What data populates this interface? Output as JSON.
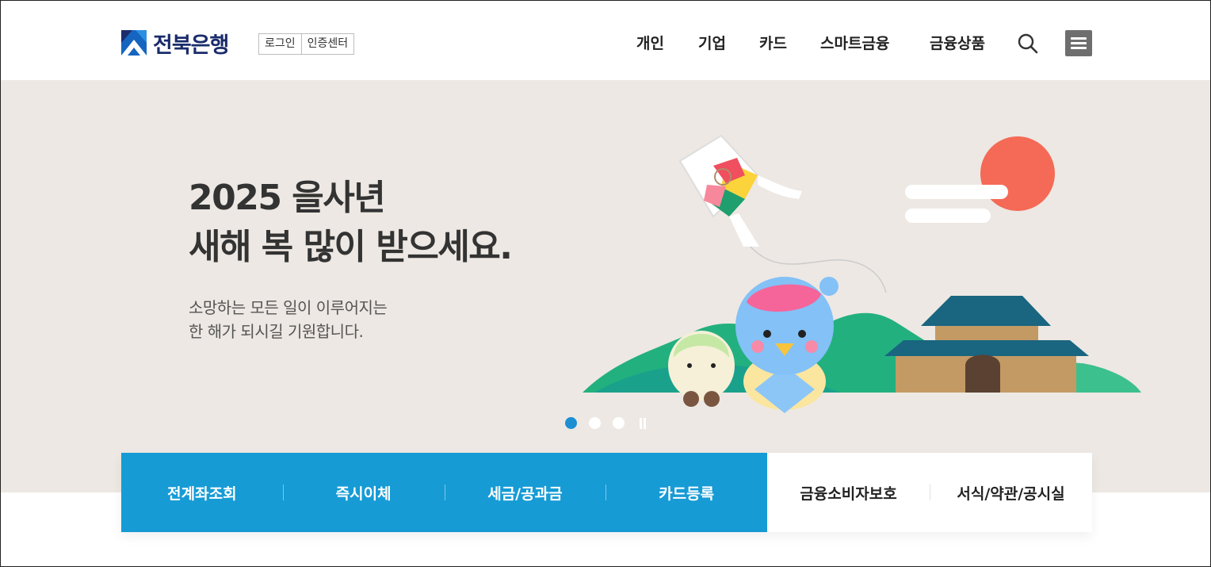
{
  "header": {
    "logo_text": "전북은행",
    "util_links": [
      "로그인",
      "인증센터"
    ],
    "nav": [
      "개인",
      "기업",
      "카드",
      "스마트금융",
      "금융상품"
    ],
    "search_icon": "search-icon",
    "menu_icon": "hamburger-menu-icon"
  },
  "hero": {
    "title_lines": [
      "2025 을사년",
      "새해 복 많이 받으세요."
    ],
    "sub_lines": [
      "소망하는 모든 일이 이루어지는",
      "한 해가 되시길 기원합니다."
    ],
    "slides_total": 3,
    "active_slide": 1,
    "pause_icon": "pause-icon"
  },
  "quick_menu": {
    "primary": [
      "전계좌조회",
      "즉시이체",
      "세금/공과금",
      "카드등록"
    ],
    "secondary": [
      "금융소비자보호",
      "서식/약관/공시실"
    ]
  },
  "colors": {
    "brand_navy": "#1a2c6b",
    "brand_blue": "#169bd5",
    "hero_bg": "#ede8e3",
    "dot_active": "#1b8fd2"
  }
}
